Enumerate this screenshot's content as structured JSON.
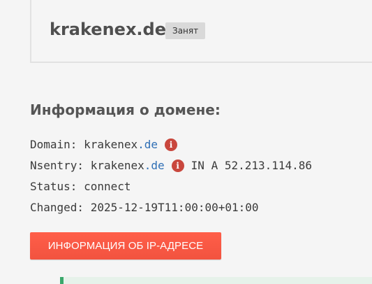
{
  "header": {
    "domain": "krakenex.de",
    "status_badge": "Занят"
  },
  "domain_info": {
    "heading": "Информация о домене:",
    "domain_line": {
      "label": "Domain:",
      "name": "krakenex",
      "tld": ".de"
    },
    "nsentry_line": {
      "label": "Nsentry:",
      "name": "krakenex",
      "tld": ".de",
      "record": "IN A 52.213.114.86"
    },
    "status_line": {
      "label": "Status:",
      "value": "connect"
    },
    "changed_line": {
      "label": "Changed:",
      "value": "2025-12-19T11:00:00+01:00"
    }
  },
  "ip_button": {
    "label": "ИНФОРМАЦИЯ ОБ IP-АДРЕСЕ"
  },
  "colors": {
    "accent_button": "#f4553f",
    "tld_link": "#2f6fb5",
    "info_icon": "#c9473d",
    "badge_bg": "#d9d9d9",
    "panel_border": "#3aa86b"
  },
  "icons": {
    "info": "info-circle-icon"
  }
}
